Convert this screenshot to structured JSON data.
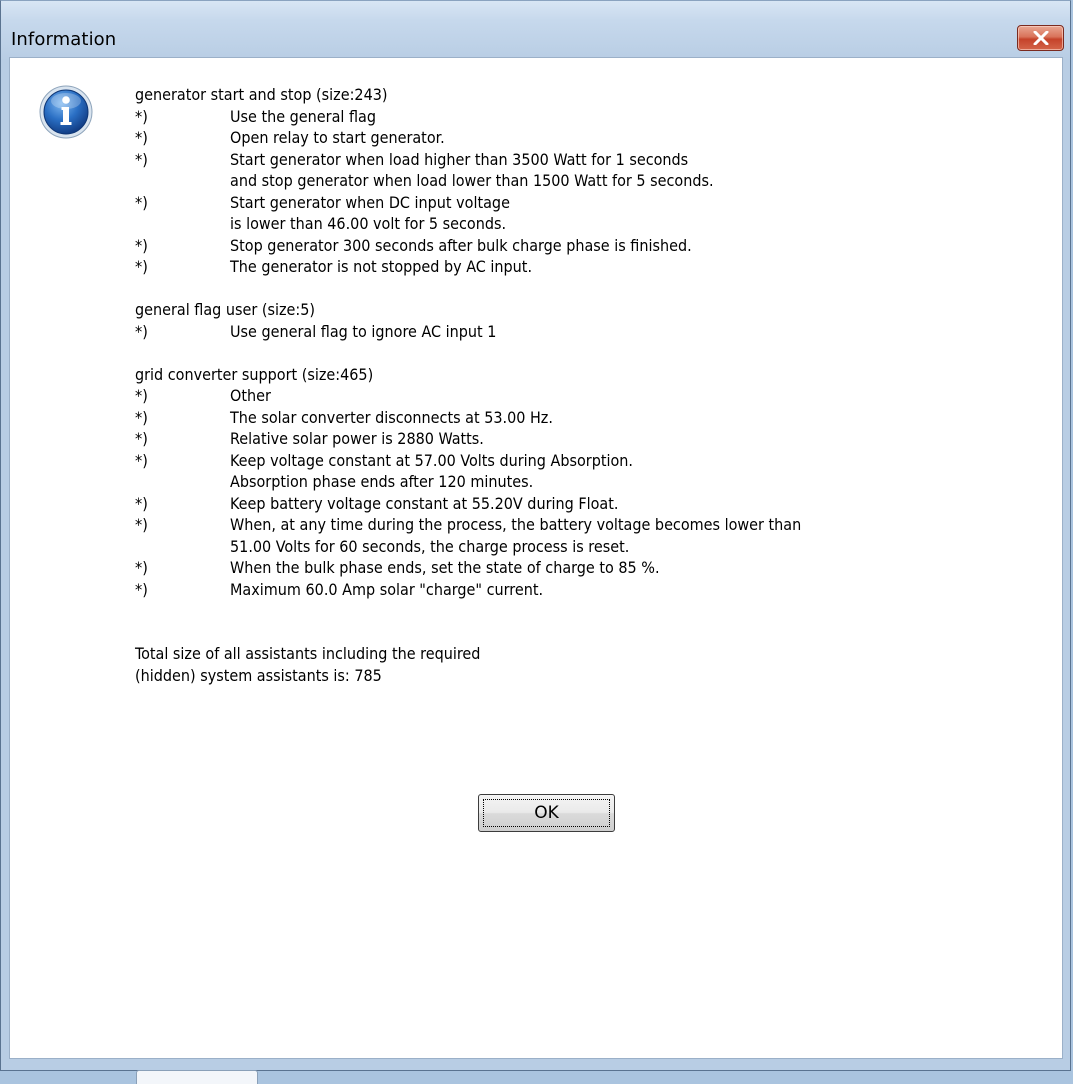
{
  "window": {
    "title": "Information",
    "close_icon": "close-icon"
  },
  "icon": "info-icon",
  "sections": {
    "generator": {
      "heading": "generator start and stop (size:243)",
      "items": [
        {
          "bullet": "*)",
          "text": "Use the general flag"
        },
        {
          "bullet": "*)",
          "text": "Open relay to start generator."
        },
        {
          "bullet": "*)",
          "text": "Start generator when load higher than 3500 Watt for 1 seconds",
          "cont": "and stop generator when load lower than 1500 Watt for 5 seconds."
        },
        {
          "bullet": "*)",
          "text": "Start generator when DC input voltage",
          "cont": "is lower than 46.00 volt for 5 seconds."
        },
        {
          "bullet": "*)",
          "text": "Stop generator 300 seconds after bulk charge phase is finished."
        },
        {
          "bullet": "*)",
          "text": "The generator is not stopped by AC input."
        }
      ]
    },
    "flag": {
      "heading": "general flag user (size:5)",
      "items": [
        {
          "bullet": "*)",
          "text": "Use general flag to ignore AC input 1"
        }
      ]
    },
    "grid": {
      "heading": "grid converter support (size:465)",
      "items": [
        {
          "bullet": "*)",
          "text": "Other"
        },
        {
          "bullet": "*)",
          "text": "The solar converter disconnects at 53.00 Hz."
        },
        {
          "bullet": "*)",
          "text": "Relative solar power is 2880 Watts."
        },
        {
          "bullet": "*)",
          "text": "Keep voltage constant at 57.00 Volts during Absorption.",
          "cont": "Absorption phase ends after 120 minutes."
        },
        {
          "bullet": "*)",
          "text": "Keep battery voltage constant at 55.20V during Float."
        },
        {
          "bullet": "*)",
          "text": "When, at any time during the process, the battery voltage becomes lower than",
          "cont": "51.00 Volts for 60 seconds, the charge process is reset."
        },
        {
          "bullet": "*)",
          "text": "When the bulk phase ends, set the state of charge to 85 %."
        },
        {
          "bullet": "*)",
          "text": "Maximum 60.0 Amp solar \"charge\" current."
        }
      ]
    }
  },
  "total": {
    "line1": "Total size of all assistants including the required",
    "line2": "(hidden) system assistants is: 785"
  },
  "ok_label": "OK"
}
